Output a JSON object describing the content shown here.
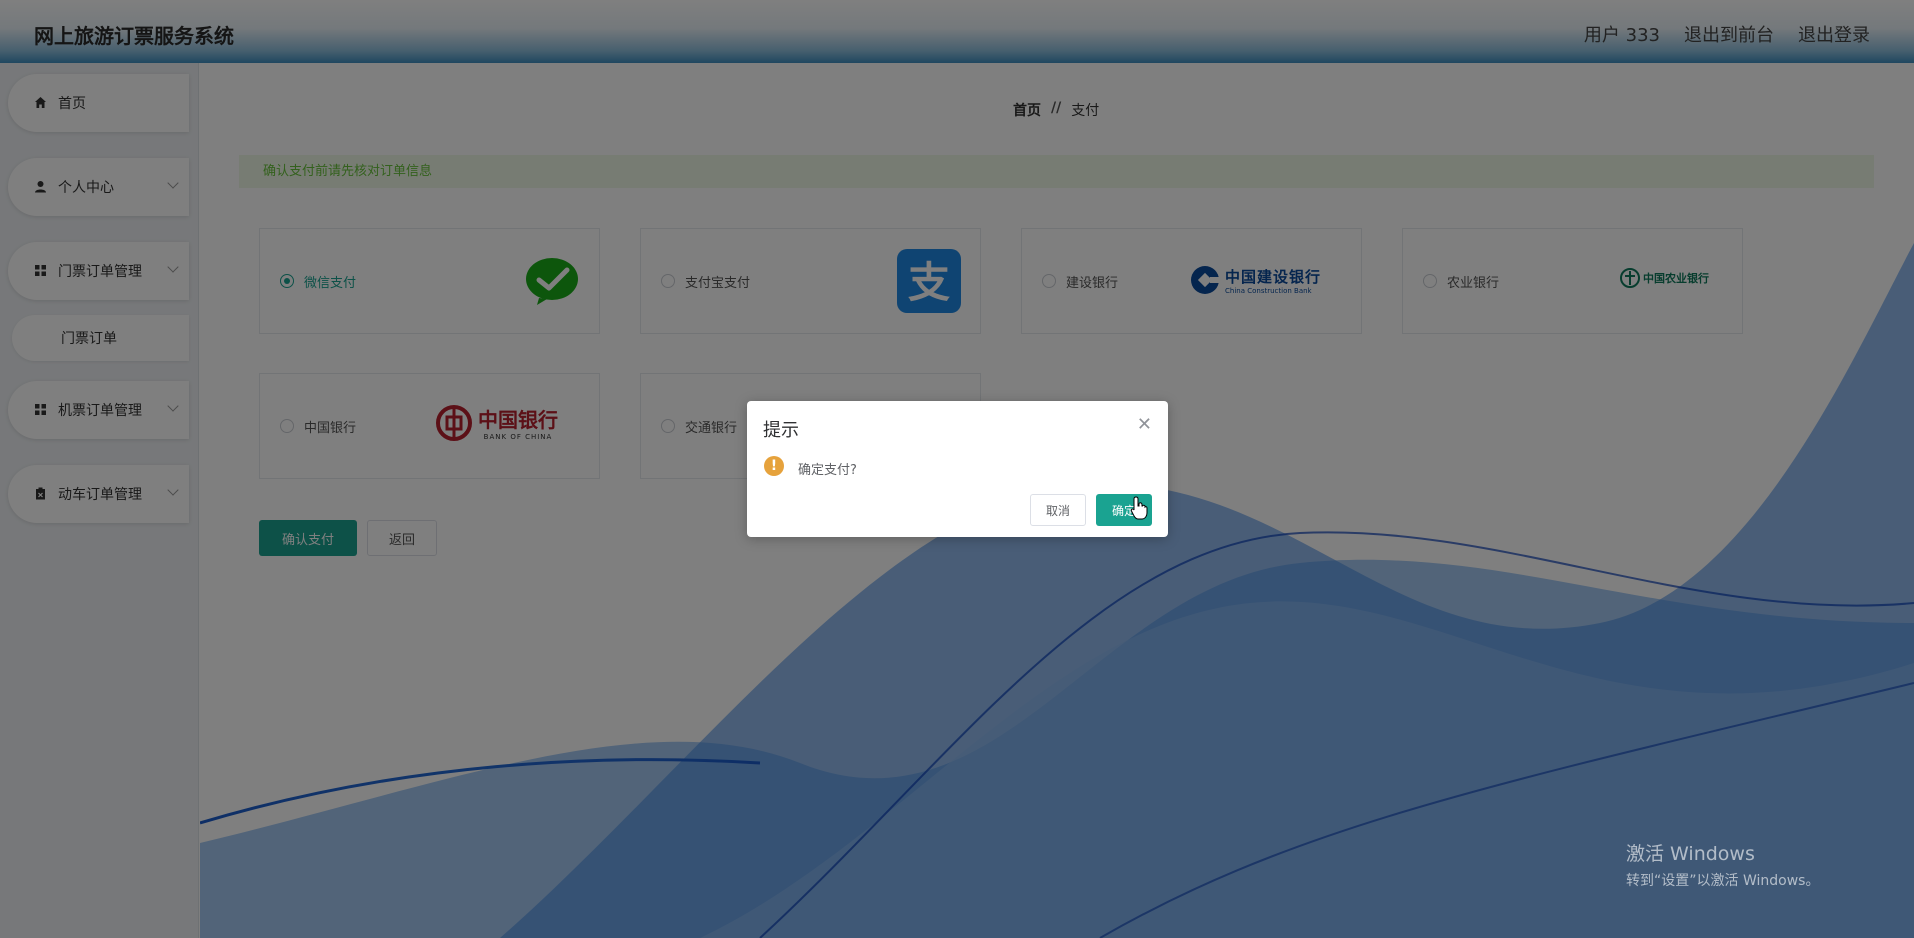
{
  "header": {
    "title": "网上旅游订票服务系统",
    "user_label": "用户 333",
    "to_front_label": "退出到前台",
    "logout_label": "退出登录"
  },
  "sidebar": {
    "items": [
      {
        "label": "首页",
        "icon": "home-icon"
      },
      {
        "label": "个人中心",
        "icon": "user-icon"
      },
      {
        "label": "门票订单管理",
        "icon": "grid-icon"
      },
      {
        "label": "门票订单",
        "icon": ""
      },
      {
        "label": "机票订单管理",
        "icon": "grid-icon"
      },
      {
        "label": "动车订单管理",
        "icon": "clipboard-icon"
      }
    ]
  },
  "breadcrumb": {
    "home": "首页",
    "separator": "//",
    "current": "支付"
  },
  "notice": "确认支付前请先核对订单信息",
  "payment_options": [
    {
      "label": "微信支付",
      "checked": true,
      "logo": "wechat-pay-logo"
    },
    {
      "label": "支付宝支付",
      "checked": false,
      "logo": "alipay-logo"
    },
    {
      "label": "建设银行",
      "checked": false,
      "logo": "ccb-logo",
      "logo_text": "中国建设银行",
      "logo_sub": "China Construction Bank"
    },
    {
      "label": "农业银行",
      "checked": false,
      "logo": "abc-logo",
      "logo_text": "中国农业银行"
    },
    {
      "label": "中国银行",
      "checked": false,
      "logo": "boc-logo",
      "logo_text": "中国银行",
      "logo_sub": "BANK OF CHINA"
    },
    {
      "label": "交通银行",
      "checked": false,
      "logo": "bocom-logo"
    }
  ],
  "buttons": {
    "confirm_pay": "确认支付",
    "back": "返回"
  },
  "dialog": {
    "title": "提示",
    "message": "确定支付?",
    "cancel": "取消",
    "ok": "确定"
  },
  "watermark": {
    "line1": "激活 Windows",
    "line2": "转到“设置”以激活 Windows。"
  },
  "colors": {
    "accent": "#1aa391",
    "notice_bg": "#eef8e6",
    "notice_text": "#67c23a",
    "warning": "#e6a23c"
  }
}
